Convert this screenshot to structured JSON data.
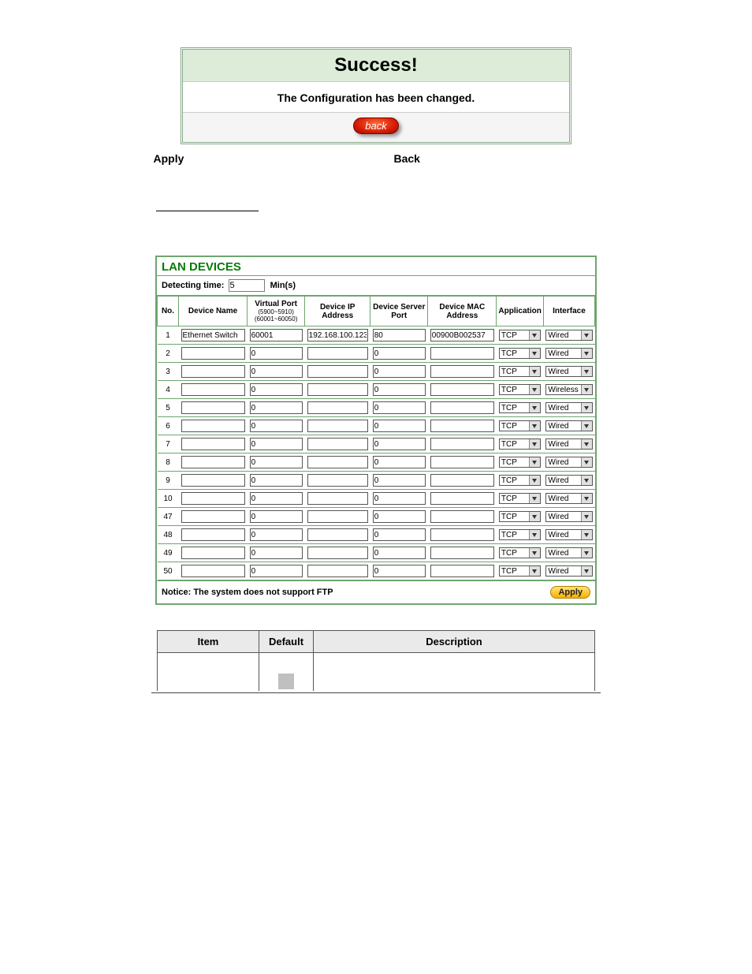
{
  "dialog": {
    "title": "Success!",
    "message": "The Configuration has been changed.",
    "back_label": "back"
  },
  "captions": {
    "apply": "Apply",
    "back": "Back"
  },
  "lan": {
    "title": "LAN DEVICES",
    "detecting_label": "Detecting time:",
    "detecting_value": "5",
    "detecting_unit": "Min(s)",
    "headers": {
      "no": "No.",
      "device_name": "Device Name",
      "virtual_port": "Virtual Port",
      "virtual_port_sub1": "(5900~5910)",
      "virtual_port_sub2": "(60001~60050)",
      "device_ip": "Device IP Address",
      "server_port": "Device Server Port",
      "mac": "Device MAC Address",
      "application": "Application",
      "interface": "Interface"
    },
    "rows": [
      {
        "no": 1,
        "name": "Ethernet Switch",
        "vport": "60001",
        "ip": "192.168.100.123",
        "sport": "80",
        "mac": "00900B002537",
        "app": "TCP",
        "iface": "Wired"
      },
      {
        "no": 2,
        "name": "",
        "vport": "0",
        "ip": "",
        "sport": "0",
        "mac": "",
        "app": "TCP",
        "iface": "Wired"
      },
      {
        "no": 3,
        "name": "",
        "vport": "0",
        "ip": "",
        "sport": "0",
        "mac": "",
        "app": "TCP",
        "iface": "Wired"
      },
      {
        "no": 4,
        "name": "",
        "vport": "0",
        "ip": "",
        "sport": "0",
        "mac": "",
        "app": "TCP",
        "iface": "Wireless"
      },
      {
        "no": 5,
        "name": "",
        "vport": "0",
        "ip": "",
        "sport": "0",
        "mac": "",
        "app": "TCP",
        "iface": "Wired"
      },
      {
        "no": 6,
        "name": "",
        "vport": "0",
        "ip": "",
        "sport": "0",
        "mac": "",
        "app": "TCP",
        "iface": "Wired"
      },
      {
        "no": 7,
        "name": "",
        "vport": "0",
        "ip": "",
        "sport": "0",
        "mac": "",
        "app": "TCP",
        "iface": "Wired"
      },
      {
        "no": 8,
        "name": "",
        "vport": "0",
        "ip": "",
        "sport": "0",
        "mac": "",
        "app": "TCP",
        "iface": "Wired"
      },
      {
        "no": 9,
        "name": "",
        "vport": "0",
        "ip": "",
        "sport": "0",
        "mac": "",
        "app": "TCP",
        "iface": "Wired"
      },
      {
        "no": 10,
        "name": "",
        "vport": "0",
        "ip": "",
        "sport": "0",
        "mac": "",
        "app": "TCP",
        "iface": "Wired"
      },
      {
        "no": 47,
        "name": "",
        "vport": "0",
        "ip": "",
        "sport": "0",
        "mac": "",
        "app": "TCP",
        "iface": "Wired"
      },
      {
        "no": 48,
        "name": "",
        "vport": "0",
        "ip": "",
        "sport": "0",
        "mac": "",
        "app": "TCP",
        "iface": "Wired"
      },
      {
        "no": 49,
        "name": "",
        "vport": "0",
        "ip": "",
        "sport": "0",
        "mac": "",
        "app": "TCP",
        "iface": "Wired"
      },
      {
        "no": 50,
        "name": "",
        "vport": "0",
        "ip": "",
        "sport": "0",
        "mac": "",
        "app": "TCP",
        "iface": "Wired"
      }
    ],
    "notice": "Notice: The system does not support FTP",
    "apply_label": "Apply"
  },
  "desc": {
    "headers": {
      "item": "Item",
      "default": "Default",
      "description": "Description"
    }
  }
}
